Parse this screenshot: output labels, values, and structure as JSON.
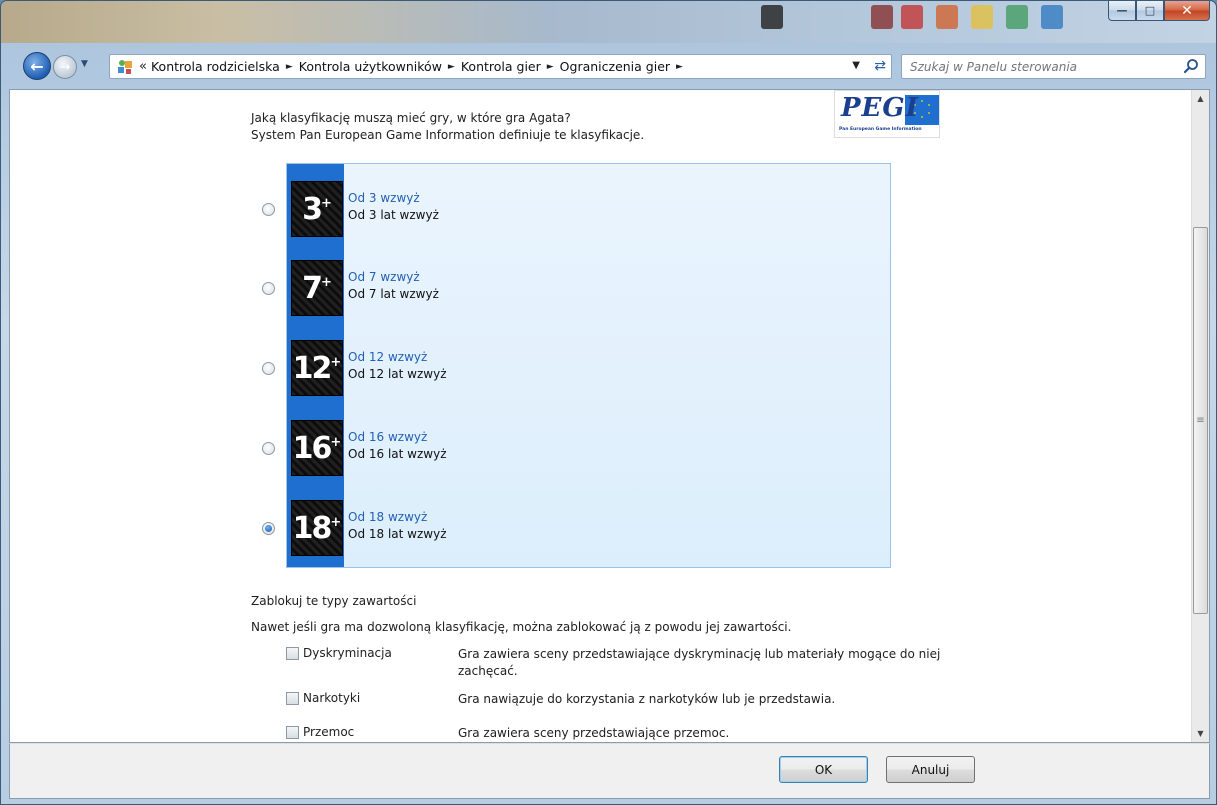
{
  "window": {
    "caption_buttons": [
      "minimize",
      "maximize",
      "close"
    ]
  },
  "address_bar": {
    "overflow": "«",
    "breadcrumbs": [
      "Kontrola rodzicielska",
      "Kontrola użytkowników",
      "Kontrola gier",
      "Ograniczenia gier"
    ]
  },
  "search": {
    "placeholder": "Szukaj w Panelu sterowania"
  },
  "content": {
    "question_line1": "Jaką klasyfikację muszą mieć gry, w które gra Agata?",
    "question_line2": "System Pan European Game Information definiuje te klasyfikacje.",
    "logo_text": "PEGI",
    "logo_subtext": "Pan European Game Information",
    "ratings": [
      {
        "badge": "3",
        "title": "Od 3 wzwyż",
        "desc": "Od 3 lat wzwyż",
        "selected": false
      },
      {
        "badge": "7",
        "title": "Od 7 wzwyż",
        "desc": "Od 7 lat wzwyż",
        "selected": false
      },
      {
        "badge": "12",
        "title": "Od 12 wzwyż",
        "desc": "Od 12 lat wzwyż",
        "selected": false
      },
      {
        "badge": "16",
        "title": "Od 16 wzwyż",
        "desc": "Od 16 lat wzwyż",
        "selected": false
      },
      {
        "badge": "18",
        "title": "Od 18 wzwyż",
        "desc": "Od 18 lat wzwyż",
        "selected": true
      }
    ],
    "block_title": "Zablokuj te typy zawartości",
    "block_desc": "Nawet jeśli gra ma dozwoloną klasyfikację, można zablokować ją z powodu jej zawartości.",
    "content_types": [
      {
        "label": "Dyskryminacja",
        "desc": "Gra zawiera sceny przedstawiające dyskryminację lub materiały mogące do niej zachęcać.",
        "checked": false
      },
      {
        "label": "Narkotyki",
        "desc": "Gra nawiązuje do korzystania z narkotyków lub je przedstawia.",
        "checked": false
      },
      {
        "label": "Przemoc",
        "desc": "Gra zawiera sceny przedstawiające przemoc.",
        "checked": false
      }
    ]
  },
  "footer": {
    "ok_label": "OK",
    "cancel_label": "Anuluj"
  },
  "colors": {
    "accent_strip": "#1f6fd1",
    "link": "#2460b4",
    "panel_bg": "#eaf4fd"
  }
}
